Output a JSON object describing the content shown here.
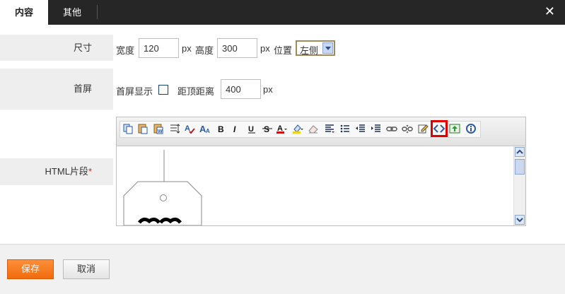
{
  "tabs": [
    {
      "label": "内容",
      "active": true
    },
    {
      "label": "其他",
      "active": false
    }
  ],
  "close_symbol": "✕",
  "size_row": {
    "label": "尺寸",
    "width_label": "宽度",
    "width_value": "120",
    "width_unit": "px",
    "height_label": "高度",
    "height_value": "300",
    "height_unit": "px",
    "position_label": "位置",
    "position_value": "左侧"
  },
  "screen_row": {
    "label": "首屏",
    "first_screen_label": "首屏显示",
    "first_screen_checked": false,
    "top_distance_label": "距顶距离",
    "top_distance_value": "400",
    "top_distance_unit": "px"
  },
  "html_row": {
    "label": "HTML片段",
    "required_mark": "*"
  },
  "toolbar": {
    "buttons": [
      "paste-icon",
      "paste-text-icon",
      "paste-word-icon",
      "line-height-icon",
      "spellcheck-icon",
      "font-size-icon",
      "bold-icon",
      "italic-icon",
      "underline-icon",
      "strikethrough-icon",
      "font-color-icon",
      "highlight-color-icon",
      "eraser-icon",
      "align-icon",
      "unordered-list-icon",
      "outdent-icon",
      "indent-icon",
      "link-icon",
      "unlink-icon",
      "edit-icon",
      "source-code-icon",
      "image-upload-icon",
      "info-icon"
    ],
    "highlighted": "source-code-icon"
  },
  "footer": {
    "save_label": "保存",
    "cancel_label": "取消"
  },
  "colors": {
    "topbar": "#262626",
    "accent": "#f07a1e",
    "highlight": "#e00000"
  }
}
